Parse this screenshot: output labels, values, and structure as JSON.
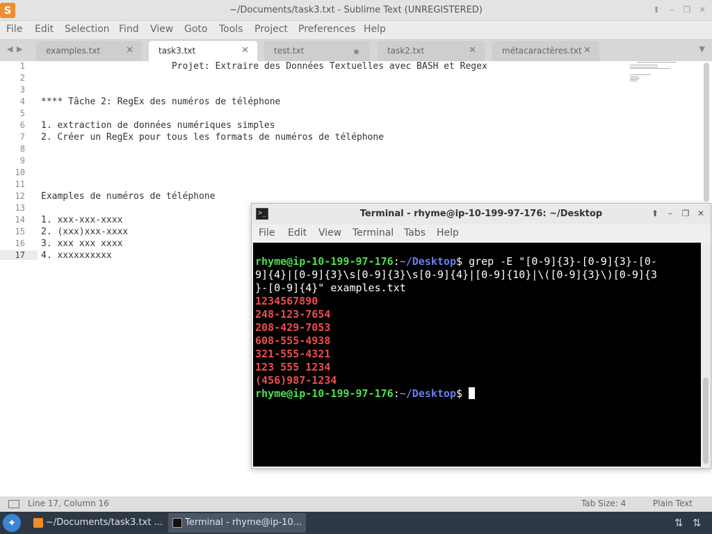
{
  "window": {
    "title": "~/Documents/task3.txt - Sublime Text (UNREGISTERED)",
    "app_icon": "S"
  },
  "menu": [
    "File",
    "Edit",
    "Selection",
    "Find",
    "View",
    "Goto",
    "Tools",
    "Project",
    "Preferences",
    "Help"
  ],
  "tabs": [
    {
      "label": "examples.txt",
      "state": "close"
    },
    {
      "label": "task3.txt",
      "state": "active"
    },
    {
      "label": "test.txt",
      "state": "modified"
    },
    {
      "label": "task2.txt",
      "state": "close"
    },
    {
      "label": "métacaractères.txt",
      "state": "close"
    }
  ],
  "editor": {
    "line_numbers": [
      "1",
      "2",
      "3",
      "4",
      "5",
      "6",
      "7",
      "8",
      "9",
      "10",
      "11",
      "12",
      "13",
      "14",
      "15",
      "16",
      "17"
    ],
    "lines": [
      "\t\t\tProjet: Extraire des Données Textuelles avec BASH et Regex",
      "",
      "",
      "**** Tâche 2: RegEx des numéros de téléphone",
      "",
      "1. extraction de données numériques simples",
      "2. Créer un RegEx pour tous les formats de numéros de téléphone",
      "",
      "",
      "",
      "",
      "Examples de numéros de téléphone",
      "",
      "1. xxx-xxx-xxxx",
      "2. (xxx)xxx-xxxx",
      "3. xxx xxx xxxx",
      "4. xxxxxxxxxx"
    ],
    "current_line": 17
  },
  "status": {
    "position": "Line 17, Column 16",
    "tab_size": "Tab Size: 4",
    "syntax": "Plain Text"
  },
  "terminal": {
    "title": "Terminal - rhyme@ip-10-199-97-176: ~/Desktop",
    "menu": [
      "File",
      "Edit",
      "View",
      "Terminal",
      "Tabs",
      "Help"
    ],
    "prompt_user": "rhyme@ip-10-199-97-176",
    "prompt_sep": ":",
    "prompt_path": "~/Desktop",
    "prompt_end": "$ ",
    "command_lines": [
      "grep -E \"[0-9]{3}-[0-9]{3}-[0-",
      "9]{4}|[0-9]{3}\\s[0-9]{3}\\s[0-9]{4}|[0-9]{10}|\\([0-9]{3}\\)[0-9]{3",
      "}-[0-9]{4}\" examples.txt"
    ],
    "output": [
      "1234567890",
      "248-123-7654",
      "208-429-7053",
      "608-555-4938",
      "321-555-4321",
      "123 555 1234",
      "(456)987-1234"
    ]
  },
  "taskbar": {
    "items": [
      {
        "label": "~/Documents/task3.txt ...",
        "active": false
      },
      {
        "label": "Terminal - rhyme@ip-10...",
        "active": true
      }
    ]
  },
  "colors": {
    "prompt_user": "#4fe04f",
    "prompt_path": "#6a7df0",
    "output": "#ef4d4d",
    "sublime_icon": "#f08c2e"
  }
}
